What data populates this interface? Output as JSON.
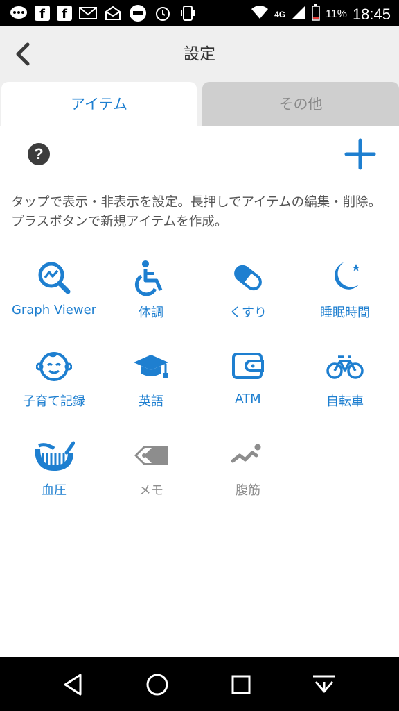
{
  "status_bar": {
    "network": "4G",
    "battery": "11%",
    "time": "18:45"
  },
  "header": {
    "title": "設定"
  },
  "tabs": [
    {
      "label": "アイテム",
      "active": true
    },
    {
      "label": "その他",
      "active": false
    }
  ],
  "description": "タップで表示・非表示を設定。長押しでアイテムの編集・削除。プラスボタンで新規アイテムを作成。",
  "items": [
    {
      "label": "Graph Viewer",
      "icon": "graph-search-icon",
      "enabled": true
    },
    {
      "label": "体調",
      "icon": "wheelchair-icon",
      "enabled": true
    },
    {
      "label": "くすり",
      "icon": "pill-icon",
      "enabled": true
    },
    {
      "label": "睡眠時間",
      "icon": "moon-star-icon",
      "enabled": true
    },
    {
      "label": "子育て記録",
      "icon": "baby-face-icon",
      "enabled": true
    },
    {
      "label": "英語",
      "icon": "graduation-cap-icon",
      "enabled": true
    },
    {
      "label": "ATM",
      "icon": "wallet-icon",
      "enabled": true
    },
    {
      "label": "自転車",
      "icon": "bicycle-icon",
      "enabled": true
    },
    {
      "label": "血圧",
      "icon": "blood-pressure-gauge-icon",
      "enabled": true
    },
    {
      "label": "メモ",
      "icon": "tag-icon",
      "enabled": false
    },
    {
      "label": "腹筋",
      "icon": "trend-line-icon",
      "enabled": false
    }
  ],
  "colors": {
    "accent": "#1e7fd0",
    "disabled": "#8d8d8d",
    "header_bg": "#efefef"
  }
}
